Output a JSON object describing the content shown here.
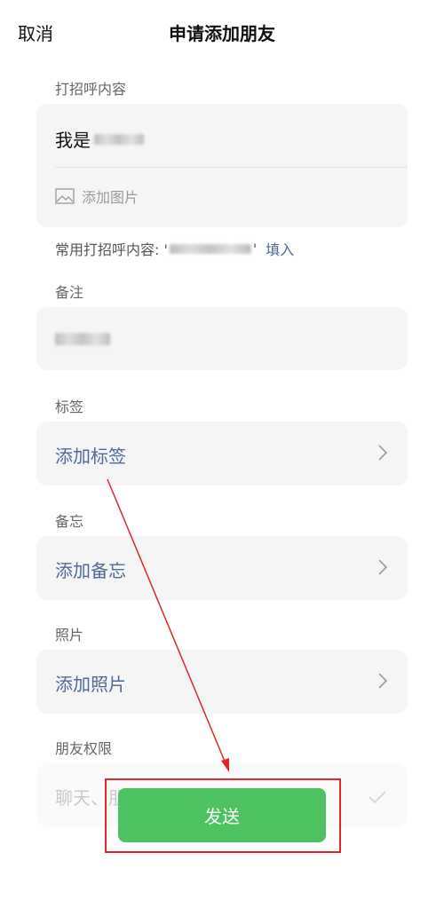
{
  "header": {
    "cancel_label": "取消",
    "title": "申请添加朋友"
  },
  "greeting": {
    "section_label": "打招呼内容",
    "text_prefix": "我是",
    "add_image_label": "添加图片",
    "common_prefix": "常用打招呼内容: '",
    "common_suffix": "'",
    "fill_label": "填入"
  },
  "remark": {
    "section_label": "备注"
  },
  "tags": {
    "section_label": "标签",
    "row_label": "添加标签"
  },
  "memo": {
    "section_label": "备忘",
    "row_label": "添加备忘"
  },
  "photos": {
    "section_label": "照片",
    "row_label": "添加照片"
  },
  "permissions": {
    "section_label": "朋友权限",
    "row_label": "聊天、朋友圈、微信运动等"
  },
  "footer": {
    "send_label": "发送"
  },
  "colors": {
    "accent_green": "#4cc260",
    "link_blue": "#4f6a96",
    "annotation_red": "#e0262a"
  }
}
